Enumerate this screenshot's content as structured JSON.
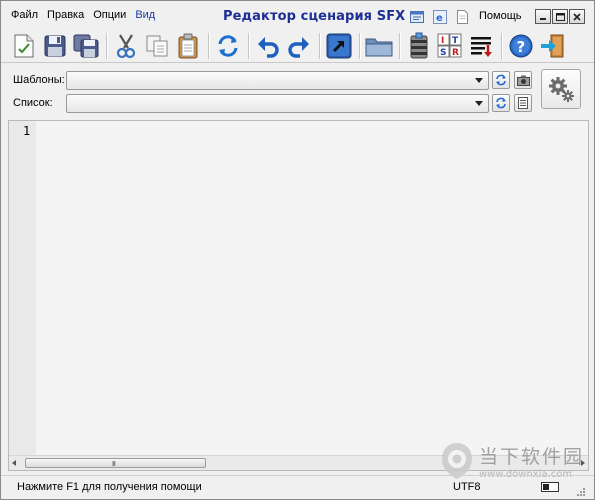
{
  "window": {
    "title": "Редактор сценария SFX",
    "help_label": "Помощь"
  },
  "menu": {
    "items": [
      {
        "label": "Файл"
      },
      {
        "label": "Правка"
      },
      {
        "label": "Опции"
      },
      {
        "label": "Вид"
      }
    ]
  },
  "toolbar": {
    "buttons": [
      "new-icon",
      "save-icon",
      "save-all-icon",
      "cut-icon",
      "copy-icon",
      "paste-icon",
      "refresh-icon",
      "undo-icon",
      "redo-icon",
      "open-link-icon",
      "folder-icon",
      "archive-icon",
      "its-r-icon",
      "text-wrap-icon",
      "help-icon",
      "exit-icon"
    ]
  },
  "templates": {
    "label": "Шаблоны:",
    "value": ""
  },
  "list": {
    "label": "Список:",
    "value": ""
  },
  "editor": {
    "line_number": "1",
    "scroll_grip": "III"
  },
  "statusbar": {
    "hint": "Нажмите F1 для получения помощи",
    "encoding": "UTF8"
  },
  "watermark": {
    "brand": "当下软件园",
    "url": "www.downxia.com"
  },
  "colors": {
    "title": "#1e2f94",
    "accent_blue": "#1a5bbf",
    "editor_bg": "#f4f4f4"
  }
}
